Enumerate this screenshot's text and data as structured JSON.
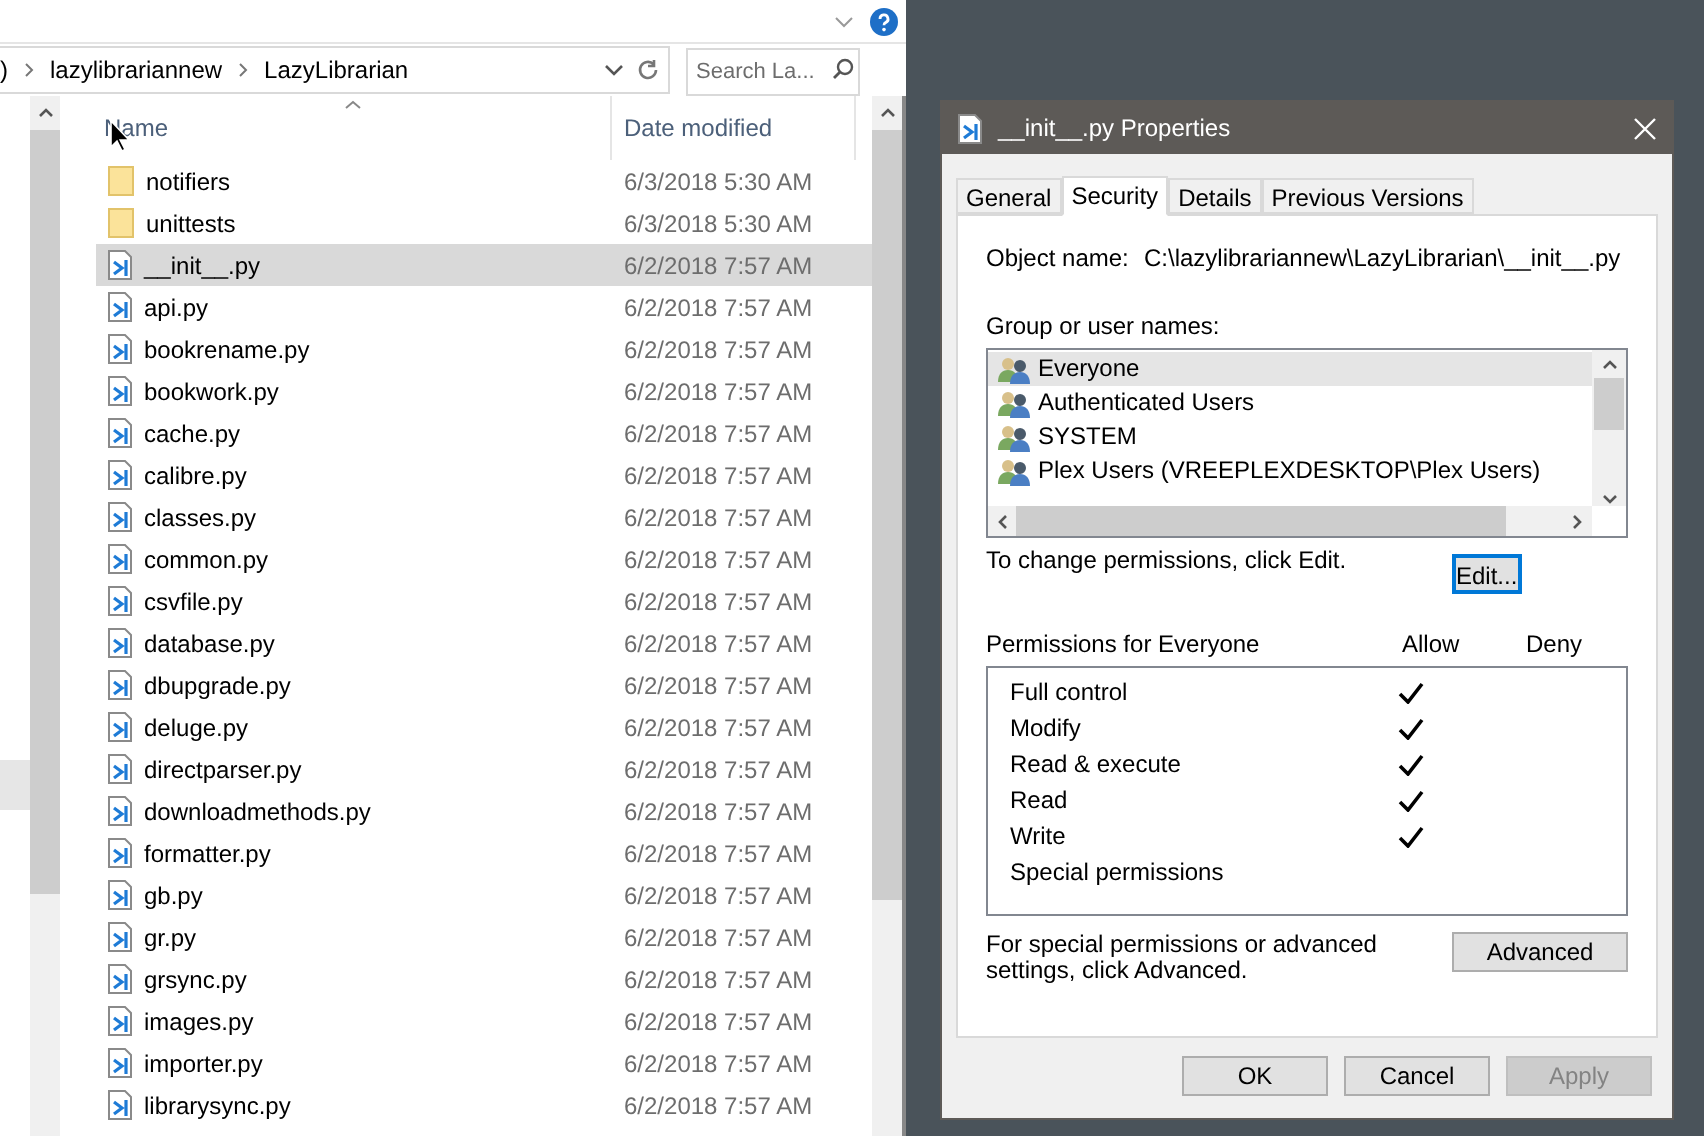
{
  "explorer": {
    "breadcrumb": [
      ")",
      "lazylibrariannew",
      "LazyLibrarian"
    ],
    "search": {
      "placeholder": "Search La..."
    },
    "columns": [
      "Name",
      "Date modified"
    ],
    "files": [
      {
        "kind": "folder",
        "name": "notifiers",
        "date": "6/3/2018 5:30 AM",
        "selected": false
      },
      {
        "kind": "folder",
        "name": "unittests",
        "date": "6/3/2018 5:30 AM",
        "selected": false
      },
      {
        "kind": "python",
        "name": "__init__.py",
        "date": "6/2/2018 7:57 AM",
        "selected": true
      },
      {
        "kind": "python",
        "name": "api.py",
        "date": "6/2/2018 7:57 AM",
        "selected": false
      },
      {
        "kind": "python",
        "name": "bookrename.py",
        "date": "6/2/2018 7:57 AM",
        "selected": false
      },
      {
        "kind": "python",
        "name": "bookwork.py",
        "date": "6/2/2018 7:57 AM",
        "selected": false
      },
      {
        "kind": "python",
        "name": "cache.py",
        "date": "6/2/2018 7:57 AM",
        "selected": false
      },
      {
        "kind": "python",
        "name": "calibre.py",
        "date": "6/2/2018 7:57 AM",
        "selected": false
      },
      {
        "kind": "python",
        "name": "classes.py",
        "date": "6/2/2018 7:57 AM",
        "selected": false
      },
      {
        "kind": "python",
        "name": "common.py",
        "date": "6/2/2018 7:57 AM",
        "selected": false
      },
      {
        "kind": "python",
        "name": "csvfile.py",
        "date": "6/2/2018 7:57 AM",
        "selected": false
      },
      {
        "kind": "python",
        "name": "database.py",
        "date": "6/2/2018 7:57 AM",
        "selected": false
      },
      {
        "kind": "python",
        "name": "dbupgrade.py",
        "date": "6/2/2018 7:57 AM",
        "selected": false
      },
      {
        "kind": "python",
        "name": "deluge.py",
        "date": "6/2/2018 7:57 AM",
        "selected": false
      },
      {
        "kind": "python",
        "name": "directparser.py",
        "date": "6/2/2018 7:57 AM",
        "selected": false
      },
      {
        "kind": "python",
        "name": "downloadmethods.py",
        "date": "6/2/2018 7:57 AM",
        "selected": false
      },
      {
        "kind": "python",
        "name": "formatter.py",
        "date": "6/2/2018 7:57 AM",
        "selected": false
      },
      {
        "kind": "python",
        "name": "gb.py",
        "date": "6/2/2018 7:57 AM",
        "selected": false
      },
      {
        "kind": "python",
        "name": "gr.py",
        "date": "6/2/2018 7:57 AM",
        "selected": false
      },
      {
        "kind": "python",
        "name": "grsync.py",
        "date": "6/2/2018 7:57 AM",
        "selected": false
      },
      {
        "kind": "python",
        "name": "images.py",
        "date": "6/2/2018 7:57 AM",
        "selected": false
      },
      {
        "kind": "python",
        "name": "importer.py",
        "date": "6/2/2018 7:57 AM",
        "selected": false
      },
      {
        "kind": "python",
        "name": "librarysync.py",
        "date": "6/2/2018 7:57 AM",
        "selected": false
      }
    ]
  },
  "dialog": {
    "title": "__init__.py Properties",
    "tabs": [
      {
        "label": "General",
        "selected": false
      },
      {
        "label": "Security",
        "selected": true
      },
      {
        "label": "Details",
        "selected": false
      },
      {
        "label": "Previous Versions",
        "selected": false
      }
    ],
    "object_name_label": "Object name:",
    "object_name": "C:\\lazylibrariannew\\LazyLibrarian\\__init__.py",
    "group_label": "Group or user names:",
    "users": [
      {
        "name": "Everyone",
        "selected": true
      },
      {
        "name": "Authenticated Users",
        "selected": false
      },
      {
        "name": "SYSTEM",
        "selected": false
      },
      {
        "name": "Plex Users (VREEPLEXDESKTOP\\Plex Users)",
        "selected": false
      }
    ],
    "change_hint": "To change permissions, click Edit.",
    "edit_button": "Edit...",
    "permissions_label": "Permissions for Everyone",
    "allow_label": "Allow",
    "deny_label": "Deny",
    "permissions": [
      {
        "name": "Full control",
        "allow": true
      },
      {
        "name": "Modify",
        "allow": true
      },
      {
        "name": "Read & execute",
        "allow": true
      },
      {
        "name": "Read",
        "allow": true
      },
      {
        "name": "Write",
        "allow": true
      },
      {
        "name": "Special permissions",
        "allow": false
      }
    ],
    "advanced_hint": "For special permissions or advanced settings, click Advanced.",
    "advanced_button": "Advanced",
    "buttons": [
      {
        "label": "OK",
        "disabled": false
      },
      {
        "label": "Cancel",
        "disabled": false
      },
      {
        "label": "Apply",
        "disabled": true
      }
    ]
  }
}
